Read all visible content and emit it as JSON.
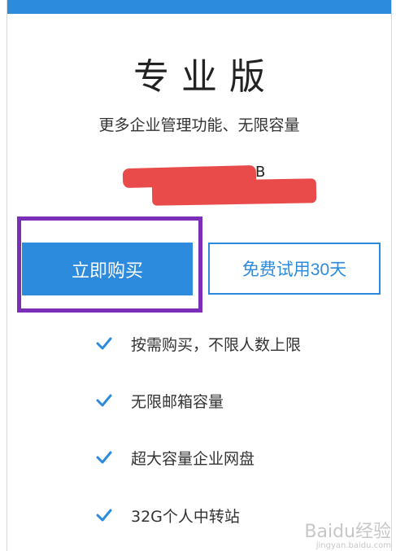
{
  "plan": {
    "title": "专业版",
    "subtitle": "更多企业管理功能、无限容量",
    "price_fragment": "B"
  },
  "buttons": {
    "buy_label": "立即购买",
    "trial_label": "免费试用30天"
  },
  "features": [
    {
      "text": "按需购买，不限人数上限",
      "icon": "check-icon"
    },
    {
      "text": "无限邮箱容量",
      "icon": "check-icon"
    },
    {
      "text": "超大容量企业网盘",
      "icon": "check-icon"
    },
    {
      "text": "32G个人中转站",
      "icon": "check-icon"
    }
  ],
  "watermark": {
    "text": "Baidu经验",
    "sub": "jingyan.baidu.com"
  },
  "colors": {
    "accent": "#2d8bde",
    "highlight": "#7b2fb8",
    "redaction": "#e94b4b"
  }
}
